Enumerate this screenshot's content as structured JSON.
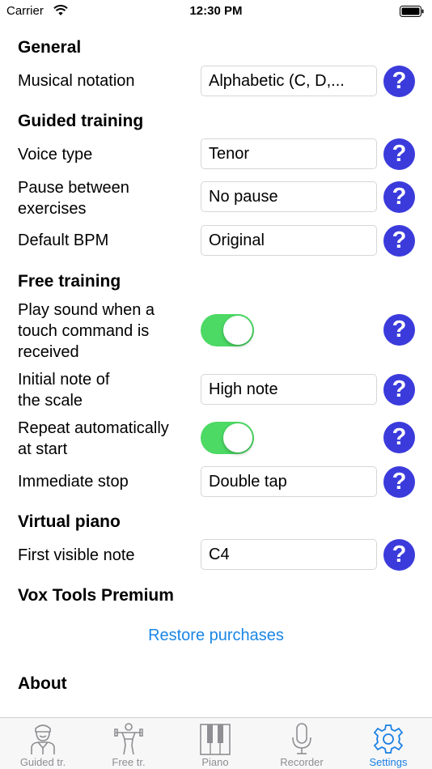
{
  "status_bar": {
    "carrier": "Carrier",
    "time": "12:30 PM"
  },
  "sections": {
    "general": "General",
    "guided": "Guided training",
    "free": "Free training",
    "piano": "Virtual piano",
    "premium": "Vox Tools Premium",
    "about": "About"
  },
  "rows": {
    "musical_notation": {
      "label": "Musical notation",
      "value": "Alphabetic (C, D,..."
    },
    "voice_type": {
      "label": "Voice type",
      "value": "Tenor"
    },
    "pause_between": {
      "label_line1": "Pause between",
      "label_line2": "exercises",
      "value": "No pause"
    },
    "default_bpm": {
      "label": "Default BPM",
      "value": "Original"
    },
    "play_sound": {
      "label_line1": "Play sound when a",
      "label_line2": "touch command is",
      "label_line3": "received",
      "toggle_on": true
    },
    "initial_note": {
      "label_line1": "Initial note of",
      "label_line2": "the scale",
      "value": "High note"
    },
    "repeat_auto": {
      "label_line1": "Repeat automatically",
      "label_line2": "at start",
      "toggle_on": true
    },
    "immediate_stop": {
      "label": "Immediate stop",
      "value": "Double tap"
    },
    "first_visible_note": {
      "label": "First visible note",
      "value": "C4"
    }
  },
  "help_symbol": "?",
  "restore_purchases": "Restore purchases",
  "tabs": [
    {
      "label": "Guided tr.",
      "icon": "singer-icon",
      "active": false
    },
    {
      "label": "Free tr.",
      "icon": "exercise-icon",
      "active": false
    },
    {
      "label": "Piano",
      "icon": "piano-icon",
      "active": false
    },
    {
      "label": "Recorder",
      "icon": "microphone-icon",
      "active": false
    },
    {
      "label": "Settings",
      "icon": "gear-icon",
      "active": true
    }
  ],
  "colors": {
    "accent": "#1a7fe4",
    "help_button": "#3b3bdc",
    "toggle_on": "#4cd964",
    "inactive_tab": "#8e8e93"
  }
}
